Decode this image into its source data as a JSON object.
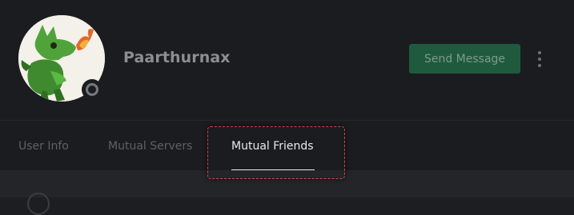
{
  "profile": {
    "username": "Paarthurnax",
    "avatar_icon": "green-dragon-avatar",
    "status": "offline"
  },
  "actions": {
    "send_message_label": "Send Message",
    "more_icon": "vertical-ellipsis-icon"
  },
  "tabs": [
    {
      "label": "User Info",
      "active": false
    },
    {
      "label": "Mutual Servers",
      "active": false
    },
    {
      "label": "Mutual Friends",
      "active": true
    }
  ],
  "colors": {
    "background": "#1c1e21",
    "button_green": "#1f5a3f",
    "highlight": "#d0453f"
  }
}
